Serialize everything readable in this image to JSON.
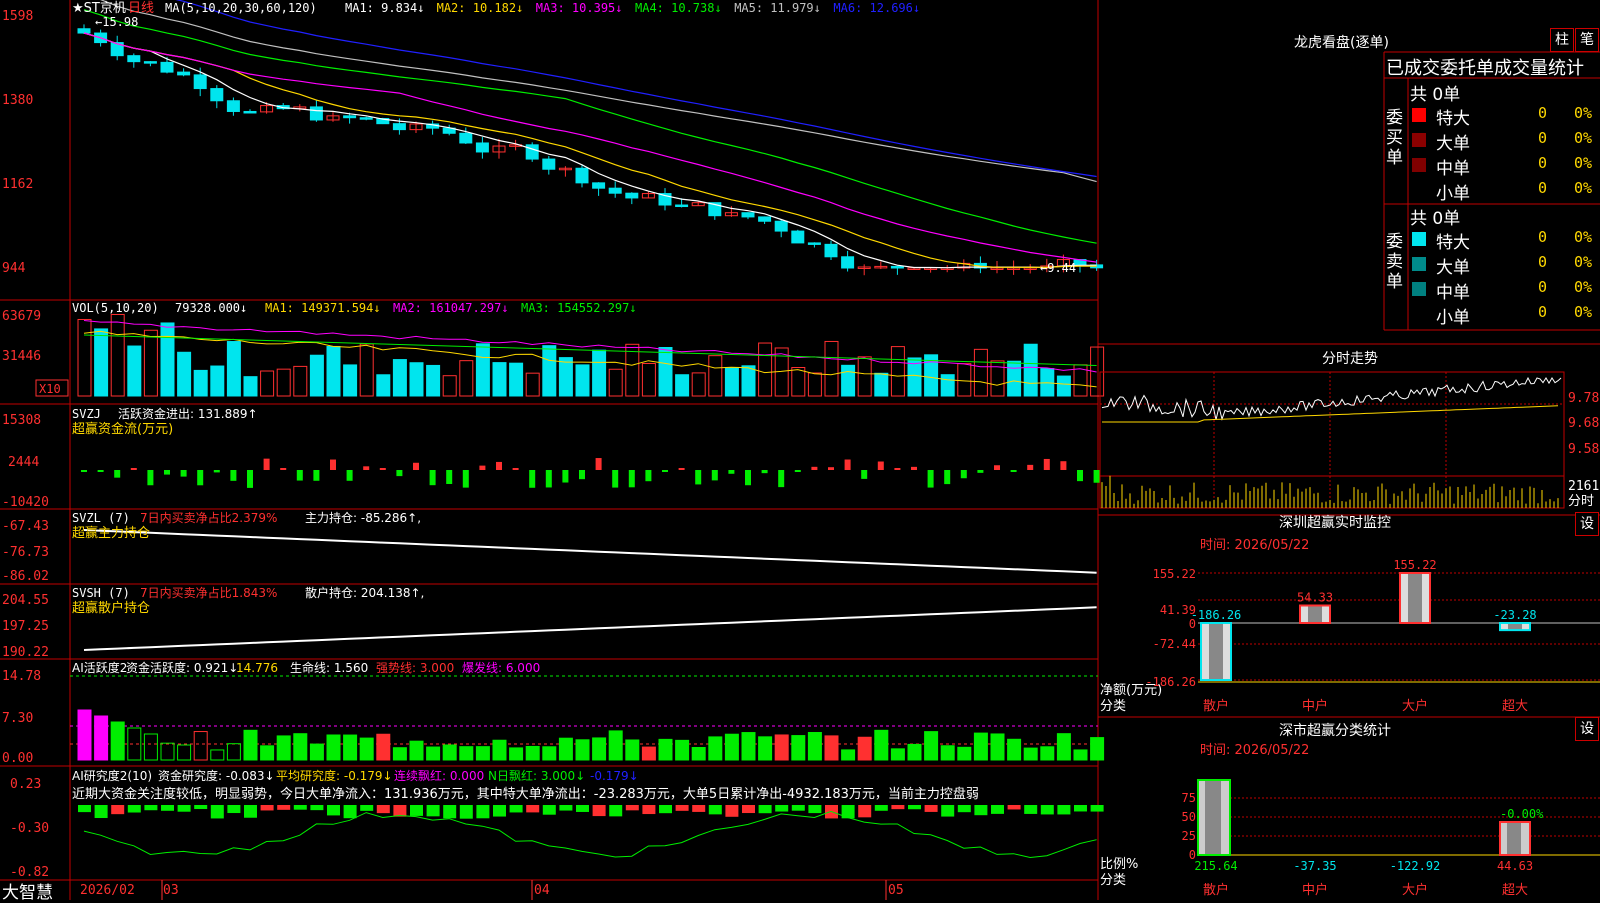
{
  "app_name": "大智慧",
  "colors": {
    "up": "#ff3030",
    "down": "#00e5ee",
    "grid": "#c00000",
    "green": "#00ee00",
    "yellow": "#ffd800",
    "magenta": "#ff00ff",
    "blue": "#2020ff",
    "white": "#ffffff",
    "gray": "#c0c0c0"
  },
  "main": {
    "legend": {
      "title": "★ST京机",
      "period": "日线",
      "ma_label": "MA(5,10,20,30,60,120)",
      "items": [
        {
          "text": "MA1: 9.834↓",
          "color": "#ffffff"
        },
        {
          "text": "MA2: 10.182↓",
          "color": "#ffd800"
        },
        {
          "text": "MA3: 10.395↓",
          "color": "#ff00ff"
        },
        {
          "text": "MA4: 10.738↓",
          "color": "#00ee00"
        },
        {
          "text": "MA5: 11.979↓",
          "color": "#c0c0c0"
        },
        {
          "text": "MA6: 12.696↓",
          "color": "#2020ff"
        }
      ]
    },
    "y_ticks": [
      "1598",
      "1380",
      "1162",
      "944"
    ],
    "high_marker": "←15.98",
    "low_marker": "←9.44"
  },
  "vol": {
    "label": "VOL(5,10,20)",
    "value": "79328.000↓",
    "ma_items": [
      {
        "text": "MA1: 149371.594↓",
        "color": "#ffd800"
      },
      {
        "text": "MA2: 161047.297↓",
        "color": "#ff00ff"
      },
      {
        "text": "MA3: 154552.297↓",
        "color": "#00ee00"
      }
    ],
    "y_ticks": [
      "63679",
      "31446"
    ],
    "unit": "X10"
  },
  "svzj": {
    "label": "SVZJ",
    "text": "活跃资金进出: 131.889↑",
    "subtitle": "超赢资金流(万元)",
    "y_ticks": [
      "15308",
      "2444",
      "-10420"
    ]
  },
  "svzl": {
    "label": "SVZL (7)",
    "ratio": "7日内买卖净占比2.379%",
    "hold": "主力持仓: -85.286↑,",
    "subtitle": "超赢主力持仓",
    "y_ticks": [
      "-67.43",
      "-76.73",
      "-86.02"
    ]
  },
  "svsh": {
    "label": "SVSH (7)",
    "ratio": "7日内买卖净占比1.843%",
    "hold": "散户持仓: 204.138↑,",
    "subtitle": "超赢散户持仓",
    "y_ticks": [
      "204.55",
      "197.25",
      "190.22"
    ]
  },
  "ai_act": {
    "items": [
      {
        "text": "AI活跃度2",
        "color": "#ffffff"
      },
      {
        "text": "资金活跃度: 0.921↓",
        "color": "#ffffff"
      },
      {
        "text": "14.776",
        "color": "#ffd800"
      },
      {
        "text": "生命线: 1.560",
        "color": "#ffffff"
      },
      {
        "text": "强势线: 3.000",
        "color": "#ff3030"
      },
      {
        "text": "爆发线: 6.000",
        "color": "#ff00ff"
      }
    ],
    "y_ticks": [
      "14.78",
      "7.30",
      "0.00"
    ]
  },
  "ai_res": {
    "items": [
      {
        "text": "AI研究度2(10)",
        "color": "#ffffff"
      },
      {
        "text": "资金研究度: -0.083↓",
        "color": "#ffffff"
      },
      {
        "text": "平均研究度: -0.179↓",
        "color": "#ffd800"
      },
      {
        "text": "连续飘红: 0.000",
        "color": "#ff00ff"
      },
      {
        "text": "N日飘红: 3.000↓",
        "color": "#00ee00"
      },
      {
        "text": "-0.179↓",
        "color": "#2020ff"
      }
    ],
    "comment": "近期大资金关注度较低，明显弱势，今日大单净流入：131.936万元，其中特大单净流出：-23.283万元，大单5日累计净出-4932.183万元，当前主力控盘弱",
    "y_ticks": [
      "0.23",
      "-0.30",
      "-0.82"
    ]
  },
  "x_axis": [
    "2026/02",
    "03",
    "04",
    "05"
  ],
  "dragon": {
    "title": "龙虎看盘(逐单)",
    "btn1": "柱",
    "btn2": "笔",
    "tabs": "已成交委托单成交量统计",
    "buy_label": "委买单",
    "sell_label": "委卖单",
    "buy_total": "共 0单",
    "sell_total": "共 0单",
    "rows": [
      {
        "name": "特大",
        "count": "0",
        "pct": "0%"
      },
      {
        "name": "大单",
        "count": "0",
        "pct": "0%"
      },
      {
        "name": "中单",
        "count": "0",
        "pct": "0%"
      },
      {
        "name": "小单",
        "count": "0",
        "pct": "0%"
      }
    ]
  },
  "intraday": {
    "title": "分时走势",
    "y_ticks": [
      "9.78",
      "9.68",
      "9.58"
    ],
    "vol_label": "2161",
    "vol_unit": "分时"
  },
  "monitor": {
    "title": "深圳超赢实时监控",
    "btn": "设",
    "time": "时间: 2026/05/22",
    "y_ticks": [
      "155.22",
      "41.39",
      "0",
      "-72.44",
      "-186.26"
    ],
    "y_title": "净额(万元)",
    "x_title": "分类",
    "chart_data": {
      "type": "bar",
      "categories": [
        "散户",
        "中户",
        "大户",
        "超大"
      ],
      "values": [
        -186.26,
        54.33,
        155.22,
        -23.28
      ],
      "ylim": [
        -186.26,
        155.22
      ]
    },
    "value_labels": [
      "-186.26",
      "54.33",
      "155.22",
      "-23.28"
    ]
  },
  "stats": {
    "title": "深市超赢分类统计",
    "btn": "设",
    "time": "时间: 2026/05/22",
    "y_ticks": [
      "75",
      "50",
      "25",
      "0"
    ],
    "y_title": "比例%",
    "x_title": "分类",
    "chart_data": {
      "type": "bar",
      "categories": [
        "散户",
        "中户",
        "大户",
        "超大"
      ],
      "values": [
        215.64,
        -37.35,
        -122.92,
        44.63
      ],
      "ylim": [
        0,
        75
      ]
    },
    "bar_label": "-0.00%",
    "value_labels": [
      "215.64",
      "-37.35",
      "-122.92",
      "44.63"
    ]
  },
  "chart_data": {
    "type": "bar",
    "categories": [
      "散户",
      "中户",
      "大户",
      "超大"
    ],
    "values": [
      -186.26,
      54.33,
      155.22,
      -23.28
    ]
  }
}
